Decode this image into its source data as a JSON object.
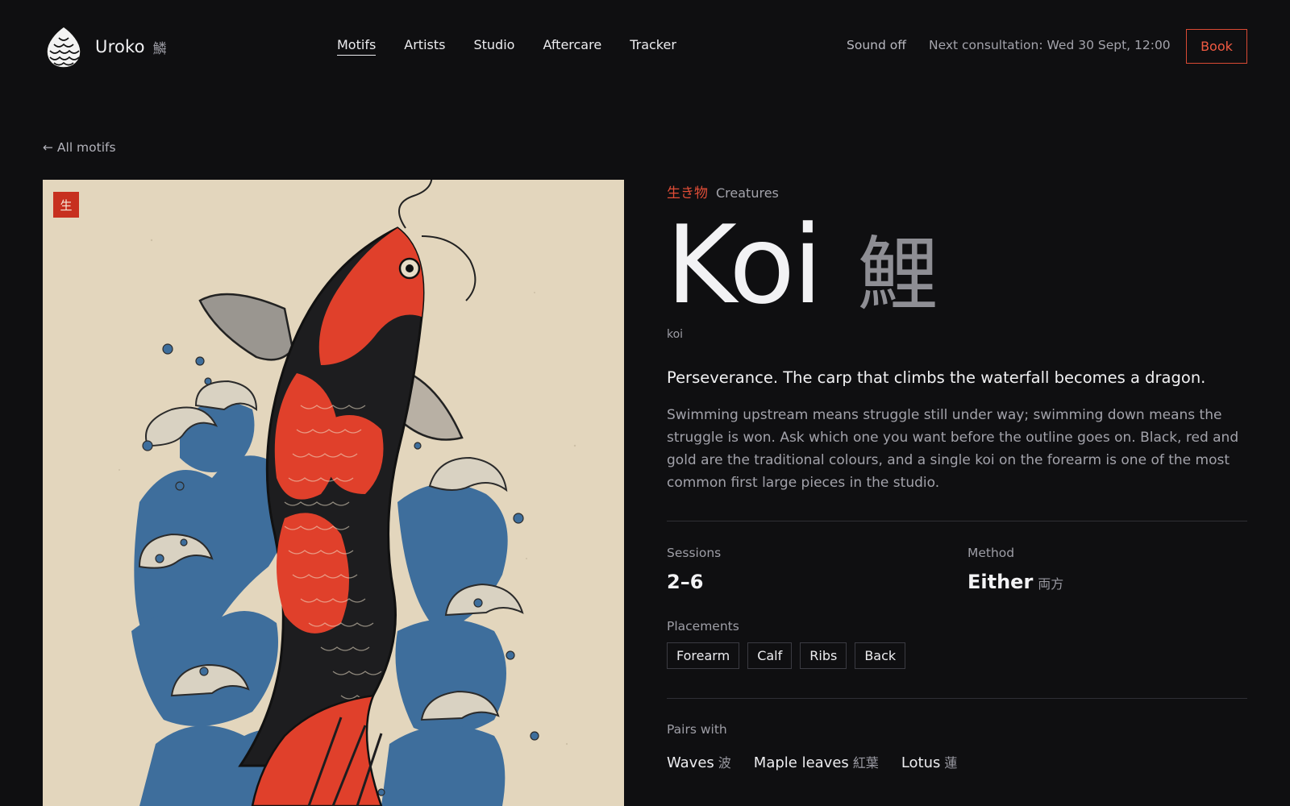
{
  "brand": {
    "name": "Uroko",
    "kanji": "鱗"
  },
  "nav": {
    "items": [
      {
        "label": "Motifs",
        "active": true
      },
      {
        "label": "Artists"
      },
      {
        "label": "Studio"
      },
      {
        "label": "Aftercare"
      },
      {
        "label": "Tracker"
      }
    ]
  },
  "header": {
    "sound": "Sound off",
    "next_consultation": "Next consultation: Wed 30 Sept, 12:00",
    "book": "Book"
  },
  "back_link": "← All motifs",
  "artwork": {
    "seal": "生"
  },
  "motif": {
    "category_jp": "生き物",
    "category_en": "Creatures",
    "title_en": "Koi",
    "title_jp": "鯉",
    "romaji": "koi",
    "tagline": "Perseverance. The carp that climbs the waterfall becomes a dragon.",
    "description": "Swimming upstream means struggle still under way; swimming down means the struggle is won. Ask which one you want before the outline goes on. Black, red and gold are the traditional colours, and a single koi on the forearm is one of the most common first large pieces in the studio."
  },
  "details": {
    "sessions_label": "Sessions",
    "sessions_value": "2–6",
    "method_label": "Method",
    "method_value": "Either",
    "method_jp": "両方",
    "placements_label": "Placements",
    "placements": [
      "Forearm",
      "Calf",
      "Ribs",
      "Back"
    ],
    "pairs_label": "Pairs with",
    "pairs": [
      {
        "en": "Waves",
        "jp": "波"
      },
      {
        "en": "Maple leaves",
        "jp": "紅葉"
      },
      {
        "en": "Lotus",
        "jp": "蓮"
      }
    ]
  },
  "colors": {
    "background": "#0f0f11",
    "accent": "#e04d37",
    "paper": "#e3d6bd",
    "koi_red": "#e0402b",
    "wave_blue": "#3e6e9c"
  }
}
